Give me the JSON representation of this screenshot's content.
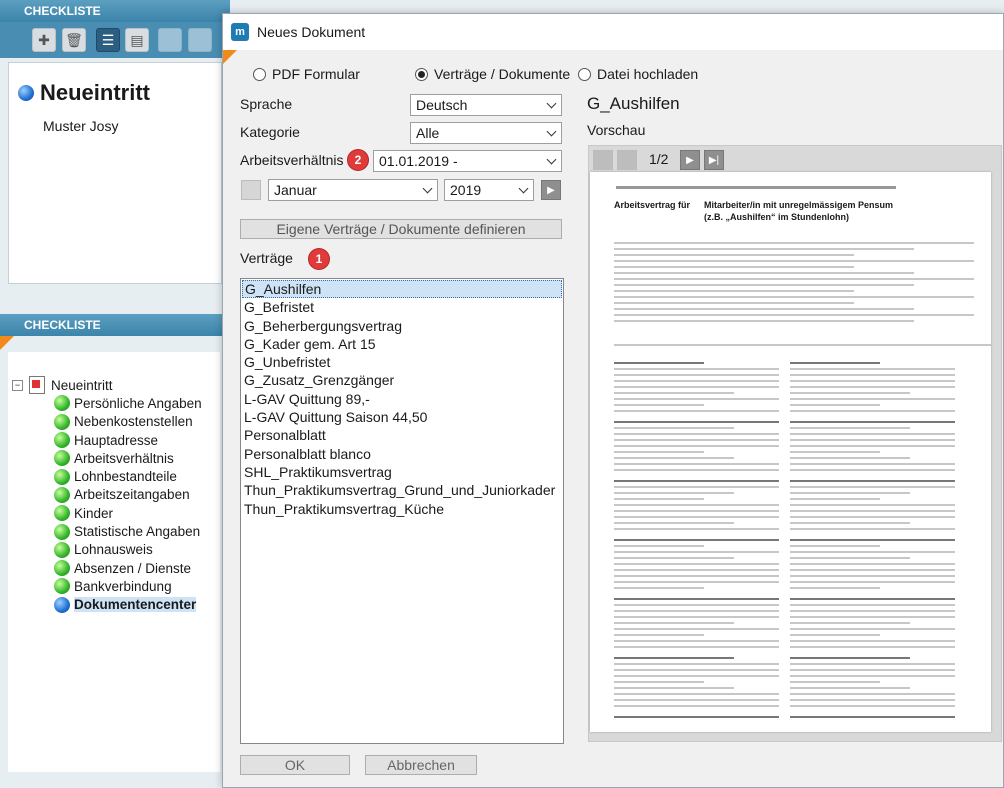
{
  "bg": {
    "header1": "CHECKLISTE",
    "header2": "CHECKLISTE",
    "title": "Neueintritt",
    "person": "Muster Josy",
    "tree_root": "Neueintritt",
    "tree_items": [
      "Persönliche Angaben",
      "Nebenkostenstellen",
      "Hauptadresse",
      "Arbeitsverhältnis",
      "Lohnbestandteile",
      "Arbeitszeitangaben",
      "Kinder",
      "Statistische Angaben",
      "Lohnausweis",
      "Absenzen / Dienste",
      "Bankverbindung",
      "Dokumentencenter"
    ]
  },
  "dialog": {
    "title": "Neues Dokument",
    "radios": [
      "PDF Formular",
      "Verträge / Dokumente",
      "Datei hochladen"
    ],
    "selected_radio": "Verträge / Dokumente",
    "sprache_label": "Sprache",
    "sprache_value": "Deutsch",
    "kategorie_label": "Kategorie",
    "kategorie_value": "Alle",
    "arbeitsverhaeltnis_label": "Arbeitsverhältnis",
    "arbeitsverhaeltnis_value": "01.01.2019 -",
    "month_value": "Januar",
    "year_value": "2019",
    "define_button": "Eigene Verträge / Dokumente definieren",
    "vertraege_label": "Verträge",
    "badge1": "1",
    "badge2": "2",
    "vertraege": [
      "G_Aushilfen",
      "G_Befristet",
      "G_Beherbergungsvertrag",
      "G_Kader gem. Art 15",
      "G_Unbefristet",
      "G_Zusatz_Grenzgänger",
      "L-GAV Quittung 89,-",
      "L-GAV Quittung Saison 44,50",
      "Personalblatt",
      "Personalblatt blanco",
      "SHL_Praktikumsvertrag",
      "Thun_Praktikumsvertrag_Grund_und_Juniorkader",
      "Thun_Praktikumsvertrag_Küche"
    ],
    "selected_vertrag": "G_Aushilfen",
    "preview_title": "G_Aushilfen",
    "preview_label": "Vorschau",
    "page_counter": "1/2",
    "ok_label": "OK",
    "cancel_label": "Abbrechen",
    "doc_heading_left": "Arbeitsvertrag für",
    "doc_heading_right1": "Mitarbeiter/in mit unregelmässigem Pensum",
    "doc_heading_right2": "(z.B. „Aushilfen“ im Stundenlohn)"
  },
  "colors": {
    "accent_orange": "#f08a1a",
    "header_blue": "#3b84ab",
    "badge_red": "#e03b3b"
  }
}
